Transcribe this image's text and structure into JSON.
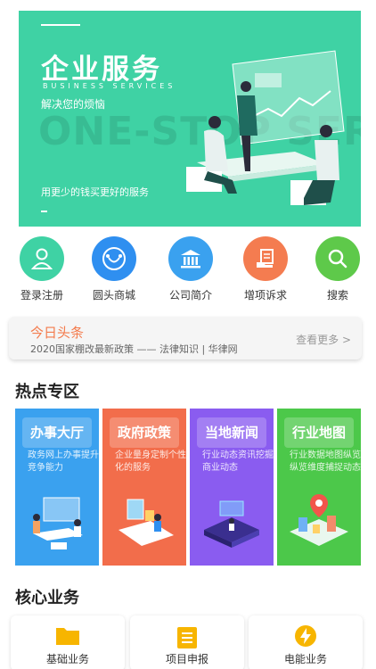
{
  "banner": {
    "title": "企业服务",
    "subtitle_en": "BUSINESS SERVICES",
    "subtitle": "解决您的烦恼",
    "watermark": "ONE-STOP SERVICE",
    "tagline": "用更少的钱买更好的服务",
    "bg_color": "#3fd2a4"
  },
  "quick_menu": [
    {
      "label": "登录注册",
      "icon": "user-icon",
      "color": "#3fd2a4"
    },
    {
      "label": "圆头商城",
      "icon": "smile-circle-icon",
      "color": "#2f8ff0"
    },
    {
      "label": "公司简介",
      "icon": "bank-icon",
      "color": "#3aa1ef"
    },
    {
      "label": "增项诉求",
      "icon": "document-hand-icon",
      "color": "#f47c50"
    },
    {
      "label": "搜索",
      "icon": "search-icon",
      "color": "#5ec94a"
    }
  ],
  "headline": {
    "title": "今日头条",
    "text": "2020国家棚改最新政策 —— 法律知识 | 华律网",
    "more": "查看更多 >"
  },
  "hot_section": {
    "title": "热点专区",
    "cards": [
      {
        "title": "办事大厅",
        "desc": "政务网上办事提升竞争能力",
        "color": "#3aa1ef",
        "icon": "meeting-illustration"
      },
      {
        "title": "政府政策",
        "desc": "企业量身定制个性化的服务",
        "color": "#f26d4b",
        "icon": "phone-illustration"
      },
      {
        "title": "当地新闻",
        "desc": "行业动态资讯挖掘商业动态",
        "color": "#8a5cf0",
        "icon": "platform-illustration"
      },
      {
        "title": "行业地图",
        "desc": "行业数据地图纵览纵览维度捕捉动态",
        "color": "#4cc84a",
        "icon": "city-map-illustration"
      }
    ]
  },
  "core_section": {
    "title": "核心业务",
    "items": [
      {
        "label": "基础业务",
        "icon": "folder-icon"
      },
      {
        "label": "项目申报",
        "icon": "clipboard-icon"
      },
      {
        "label": "电能业务",
        "icon": "lightning-icon"
      }
    ]
  }
}
